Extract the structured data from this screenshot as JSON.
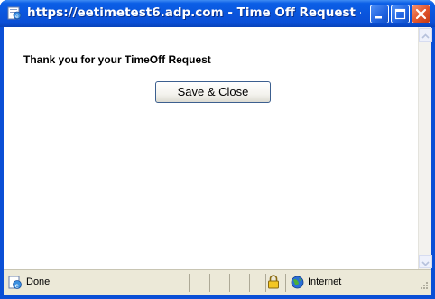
{
  "window": {
    "title": "https://eetimetest6.adp.com - Time Off Request - T...",
    "title_icon": "ie-page-icon",
    "controls": [
      "minimize",
      "maximize",
      "close"
    ]
  },
  "content": {
    "message": "Thank you for your TimeOff Request",
    "save_button_label": "Save & Close"
  },
  "statusbar": {
    "status_text": "Done",
    "zone_text": "Internet",
    "lock_icon": "padlock-icon",
    "zone_icon": "globe-icon"
  },
  "colors": {
    "titlebar": "#0a4fd6",
    "close_button": "#e0532b",
    "statusbar": "#ece9d8"
  }
}
